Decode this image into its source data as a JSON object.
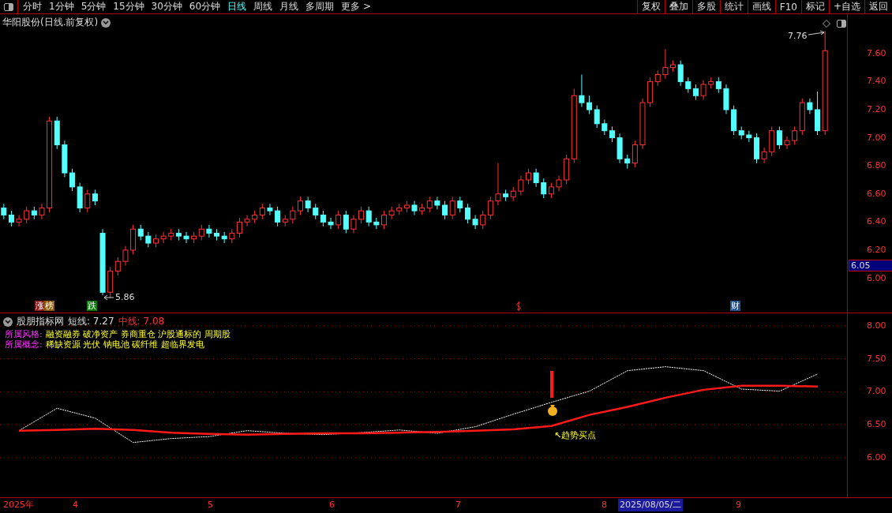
{
  "toolbar": {
    "periods": [
      {
        "label": "分时",
        "selected": false
      },
      {
        "label": "1分钟",
        "selected": false
      },
      {
        "label": "5分钟",
        "selected": false
      },
      {
        "label": "15分钟",
        "selected": false
      },
      {
        "label": "30分钟",
        "selected": false
      },
      {
        "label": "60分钟",
        "selected": false
      },
      {
        "label": "日线",
        "selected": true
      },
      {
        "label": "周线",
        "selected": false
      },
      {
        "label": "月线",
        "selected": false
      },
      {
        "label": "多周期",
        "selected": false
      },
      {
        "label": "更多 >",
        "selected": false
      }
    ],
    "buttons": [
      "复权",
      "叠加",
      "多股",
      "统计",
      "画线",
      "F10",
      "标记",
      "+自选",
      "返回"
    ]
  },
  "price_chart": {
    "title": "华阳股份(日线.前复权)",
    "current_price": "6.05",
    "high_label": "7.76",
    "low_label": "5.86",
    "markers": [
      {
        "label": "涨",
        "color": "#8b1a1a"
      },
      {
        "label": "榜",
        "color": "#8b5a10"
      },
      {
        "label": "跌",
        "color": "#0a7a0a"
      },
      {
        "label": "财",
        "color": "#1f4f8f"
      }
    ],
    "chart_data": {
      "type": "candlestick",
      "ylim": [
        5.75,
        7.88
      ],
      "yticks": [
        {
          "value": 7.6,
          "label": "7.60"
        },
        {
          "value": 7.4,
          "label": "7.40"
        },
        {
          "value": 7.2,
          "label": "7.20"
        },
        {
          "value": 7,
          "label": "7.00"
        },
        {
          "value": 6.8,
          "label": "6.80"
        },
        {
          "value": 6.6,
          "label": "6.60"
        },
        {
          "value": 6.4,
          "label": "6.40"
        },
        {
          "value": 6.2,
          "label": "6.20"
        },
        {
          "value": 6,
          "label": "6.00"
        }
      ],
      "categories": [
        null,
        null,
        null,
        null,
        null,
        null,
        null,
        null,
        null,
        null,
        null,
        null,
        null,
        null,
        null,
        null,
        null,
        null,
        null,
        null,
        null,
        null,
        null,
        null,
        null,
        null,
        null,
        null,
        null,
        null,
        null,
        null,
        null,
        null,
        null,
        null,
        null,
        null,
        null,
        null,
        null,
        null,
        null,
        null,
        null,
        null,
        null,
        null,
        null,
        null,
        null,
        null,
        null,
        null,
        null,
        null,
        null,
        null,
        null,
        null,
        null,
        null,
        null,
        null,
        null,
        null,
        null,
        null,
        null,
        null,
        null,
        null,
        null,
        null,
        null,
        null,
        null,
        null,
        null,
        null,
        null,
        null,
        null,
        null,
        null,
        null,
        null,
        null,
        null,
        null,
        null,
        null,
        null,
        null,
        null,
        null,
        null,
        null,
        null,
        null,
        null,
        null,
        null,
        null,
        null,
        null,
        null,
        null,
        null
      ],
      "ohlc": [
        [
          6.5,
          6.53,
          6.42,
          6.45
        ],
        [
          6.45,
          6.48,
          6.37,
          6.4
        ],
        [
          6.4,
          6.45,
          6.37,
          6.42
        ],
        [
          6.42,
          6.51,
          6.39,
          6.48
        ],
        [
          6.48,
          6.51,
          6.42,
          6.45
        ],
        [
          6.45,
          6.53,
          6.42,
          6.5
        ],
        [
          6.5,
          7.15,
          6.47,
          7.12
        ],
        [
          7.12,
          7.15,
          6.92,
          6.95
        ],
        [
          6.95,
          6.98,
          6.72,
          6.75
        ],
        [
          6.75,
          6.78,
          6.62,
          6.65
        ],
        [
          6.65,
          6.68,
          6.47,
          6.5
        ],
        [
          6.5,
          6.63,
          6.47,
          6.6
        ],
        [
          6.6,
          6.63,
          6.52,
          6.55
        ],
        [
          6.32,
          6.35,
          5.88,
          5.9
        ],
        [
          5.9,
          6.08,
          5.86,
          6.05
        ],
        [
          6.05,
          6.15,
          6.02,
          6.12
        ],
        [
          6.12,
          6.23,
          6.09,
          6.2
        ],
        [
          6.2,
          6.38,
          6.17,
          6.35
        ],
        [
          6.35,
          6.38,
          6.27,
          6.3
        ],
        [
          6.3,
          6.33,
          6.22,
          6.25
        ],
        [
          6.25,
          6.31,
          6.22,
          6.28
        ],
        [
          6.28,
          6.33,
          6.25,
          6.3
        ],
        [
          6.3,
          6.35,
          6.27,
          6.32
        ],
        [
          6.32,
          6.35,
          6.27,
          6.3
        ],
        [
          6.3,
          6.33,
          6.25,
          6.28
        ],
        [
          6.28,
          6.33,
          6.25,
          6.3
        ],
        [
          6.3,
          6.38,
          6.27,
          6.35
        ],
        [
          6.35,
          6.38,
          6.29,
          6.32
        ],
        [
          6.32,
          6.35,
          6.27,
          6.3
        ],
        [
          6.3,
          6.33,
          6.25,
          6.28
        ],
        [
          6.28,
          6.35,
          6.25,
          6.32
        ],
        [
          6.32,
          6.43,
          6.29,
          6.4
        ],
        [
          6.4,
          6.45,
          6.37,
          6.42
        ],
        [
          6.42,
          6.48,
          6.39,
          6.45
        ],
        [
          6.45,
          6.53,
          6.42,
          6.5
        ],
        [
          6.5,
          6.53,
          6.45,
          6.48
        ],
        [
          6.48,
          6.51,
          6.37,
          6.4
        ],
        [
          6.4,
          6.45,
          6.37,
          6.42
        ],
        [
          6.42,
          6.51,
          6.39,
          6.48
        ],
        [
          6.48,
          6.58,
          6.45,
          6.55
        ],
        [
          6.55,
          6.58,
          6.47,
          6.5
        ],
        [
          6.5,
          6.53,
          6.42,
          6.45
        ],
        [
          6.45,
          6.48,
          6.37,
          6.4
        ],
        [
          6.4,
          6.43,
          6.35,
          6.38
        ],
        [
          6.38,
          6.48,
          6.35,
          6.45
        ],
        [
          6.45,
          6.48,
          6.32,
          6.35
        ],
        [
          6.35,
          6.45,
          6.32,
          6.42
        ],
        [
          6.42,
          6.51,
          6.39,
          6.48
        ],
        [
          6.48,
          6.51,
          6.37,
          6.4
        ],
        [
          6.4,
          6.43,
          6.35,
          6.38
        ],
        [
          6.38,
          6.48,
          6.35,
          6.45
        ],
        [
          6.45,
          6.51,
          6.42,
          6.48
        ],
        [
          6.48,
          6.53,
          6.45,
          6.5
        ],
        [
          6.5,
          6.55,
          6.47,
          6.52
        ],
        [
          6.52,
          6.55,
          6.45,
          6.48
        ],
        [
          6.48,
          6.53,
          6.45,
          6.5
        ],
        [
          6.5,
          6.58,
          6.47,
          6.55
        ],
        [
          6.55,
          6.58,
          6.49,
          6.52
        ],
        [
          6.52,
          6.55,
          6.42,
          6.45
        ],
        [
          6.45,
          6.58,
          6.42,
          6.55
        ],
        [
          6.55,
          6.58,
          6.47,
          6.5
        ],
        [
          6.5,
          6.53,
          6.39,
          6.42
        ],
        [
          6.42,
          6.45,
          6.35,
          6.38
        ],
        [
          6.38,
          6.48,
          6.35,
          6.45
        ],
        [
          6.45,
          6.58,
          6.42,
          6.55
        ],
        [
          6.55,
          6.82,
          6.52,
          6.6
        ],
        [
          6.6,
          6.63,
          6.55,
          6.58
        ],
        [
          6.58,
          6.65,
          6.55,
          6.62
        ],
        [
          6.62,
          6.73,
          6.59,
          6.7
        ],
        [
          6.7,
          6.78,
          6.67,
          6.75
        ],
        [
          6.75,
          6.78,
          6.65,
          6.68
        ],
        [
          6.68,
          6.71,
          6.57,
          6.6
        ],
        [
          6.6,
          6.68,
          6.57,
          6.65
        ],
        [
          6.65,
          6.73,
          6.62,
          6.7
        ],
        [
          6.7,
          6.88,
          6.67,
          6.85
        ],
        [
          6.85,
          7.35,
          6.82,
          7.3
        ],
        [
          7.3,
          7.45,
          7.22,
          7.25
        ],
        [
          7.25,
          7.3,
          7.17,
          7.2
        ],
        [
          7.2,
          7.23,
          7.07,
          7.1
        ],
        [
          7.1,
          7.13,
          7.02,
          7.05
        ],
        [
          7.05,
          7.08,
          6.97,
          7.0
        ],
        [
          7.0,
          7.03,
          6.82,
          6.85
        ],
        [
          6.85,
          6.88,
          6.78,
          6.82
        ],
        [
          6.82,
          6.98,
          6.79,
          6.95
        ],
        [
          6.95,
          7.28,
          6.92,
          7.25
        ],
        [
          7.25,
          7.43,
          7.22,
          7.4
        ],
        [
          7.4,
          7.48,
          7.37,
          7.45
        ],
        [
          7.45,
          7.63,
          7.42,
          7.5
        ],
        [
          7.5,
          7.55,
          7.47,
          7.52
        ],
        [
          7.52,
          7.55,
          7.37,
          7.4
        ],
        [
          7.4,
          7.43,
          7.32,
          7.35
        ],
        [
          7.35,
          7.38,
          7.27,
          7.3
        ],
        [
          7.3,
          7.41,
          7.27,
          7.38
        ],
        [
          7.38,
          7.43,
          7.35,
          7.4
        ],
        [
          7.4,
          7.43,
          7.32,
          7.35
        ],
        [
          7.35,
          7.38,
          7.17,
          7.2
        ],
        [
          7.2,
          7.23,
          7.02,
          7.05
        ],
        [
          7.05,
          7.08,
          6.99,
          7.02
        ],
        [
          7.02,
          7.05,
          6.97,
          7.0
        ],
        [
          7.0,
          7.03,
          6.82,
          6.85
        ],
        [
          6.85,
          6.93,
          6.82,
          6.9
        ],
        [
          6.9,
          7.08,
          6.87,
          7.05
        ],
        [
          7.05,
          7.08,
          6.92,
          6.95
        ],
        [
          6.95,
          7.01,
          6.92,
          6.98
        ],
        [
          6.98,
          7.08,
          6.95,
          7.05
        ],
        [
          7.05,
          7.28,
          7.02,
          7.25
        ],
        [
          7.25,
          7.28,
          7.17,
          7.2
        ],
        [
          7.2,
          7.33,
          7.02,
          7.05
        ],
        [
          7.05,
          7.76,
          7.02,
          7.62
        ]
      ]
    }
  },
  "indicator": {
    "name": "股朋指标网",
    "legend_separator": ":",
    "short_value": "7.27",
    "mid_value": "7.08",
    "style_label": "所属风格:",
    "style_value": "融资融券 破净资产 券商重仓 沪股通标的 周期股",
    "concept_label": "所属概念:",
    "concept_value": "稀缺资源 光伏 钠电池 碳纤维 超临界发电",
    "signal_label": "↖趋势买点",
    "chart_data": {
      "type": "line",
      "categories": [
        null,
        null,
        null,
        null,
        null,
        null,
        null,
        null,
        null,
        null,
        null,
        null,
        null,
        null,
        null,
        null,
        null,
        null,
        null,
        null,
        null,
        null
      ],
      "ylim": [
        5.4,
        8.19
      ],
      "grid": true,
      "yticks": [
        {
          "value": 8,
          "label": "8.00"
        },
        {
          "value": 7.5,
          "label": "7.50"
        },
        {
          "value": 7,
          "label": "7.00"
        },
        {
          "value": 6.5,
          "label": "6.50"
        },
        {
          "value": 6,
          "label": "6.00"
        }
      ],
      "series": [
        {
          "name": "短线",
          "color": "#ffffff",
          "line_style": "dashed",
          "values": [
            6.41,
            6.75,
            6.6,
            6.23,
            6.29,
            6.32,
            6.41,
            6.37,
            6.35,
            6.38,
            6.42,
            6.37,
            6.47,
            6.66,
            6.84,
            7.01,
            7.32,
            7.38,
            7.32,
            7.04,
            7.01,
            7.27
          ]
        },
        {
          "name": "中线",
          "color": "#ff1a1a",
          "line_style": "solid",
          "values": [
            6.41,
            6.42,
            6.44,
            6.42,
            6.38,
            6.36,
            6.35,
            6.36,
            6.37,
            6.37,
            6.38,
            6.39,
            6.41,
            6.43,
            6.48,
            6.65,
            6.77,
            6.91,
            7.03,
            7.09,
            7.09,
            7.08
          ]
        }
      ]
    }
  },
  "time_axis": [
    {
      "label": "2025年",
      "selected": false
    },
    {
      "label": "4",
      "selected": false
    },
    {
      "label": "5",
      "selected": false
    },
    {
      "label": "6",
      "selected": false
    },
    {
      "label": "7",
      "selected": false
    },
    {
      "label": "8",
      "selected": false
    },
    {
      "label": "2025/08/05/二",
      "selected": true
    },
    {
      "label": "9",
      "selected": false
    }
  ]
}
